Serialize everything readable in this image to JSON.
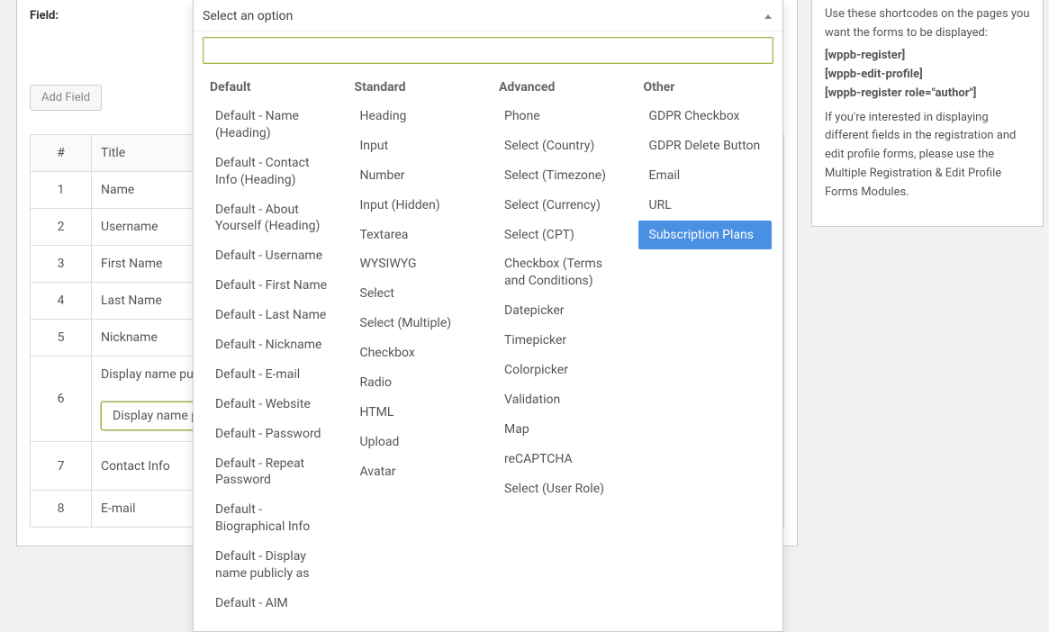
{
  "field_label": "Field:",
  "add_field_label": "Add Field",
  "table": {
    "headers": {
      "num": "#",
      "title": "Title"
    },
    "rows": [
      {
        "num": "1",
        "title": "Name"
      },
      {
        "num": "2",
        "title": "Username"
      },
      {
        "num": "3",
        "title": "First Name"
      },
      {
        "num": "4",
        "title": "Last Name"
      },
      {
        "num": "5",
        "title": "Nickname"
      },
      {
        "num": "6",
        "title": "Display name pu",
        "inline_select": "Display name p"
      },
      {
        "num": "7",
        "title": "Contact Info"
      },
      {
        "num": "8",
        "title": "E-mail"
      }
    ]
  },
  "sidebar": {
    "intro": "Use these shortcodes on the pages you want the forms to be displayed:",
    "shortcodes": [
      "[wppb-register]",
      "[wppb-edit-profile]",
      "[wppb-register role=\"author\"]"
    ],
    "outro": "If you're interested in displaying different fields in the registration and edit profile forms, please use the Multiple Registration & Edit Profile Forms Modules."
  },
  "dropdown": {
    "placeholder_header": "Select an option",
    "search_value": "",
    "columns": [
      {
        "heading": "Default",
        "items": [
          "Default - Name (Heading)",
          "Default - Contact Info (Heading)",
          "Default - About Yourself (Heading)",
          "Default - Username",
          "Default - First Name",
          "Default - Last Name",
          "Default - Nickname",
          "Default - E-mail",
          "Default - Website",
          "Default - Password",
          "Default - Repeat Password",
          "Default - Biographical Info",
          "Default - Display name publicly as",
          "Default - AIM"
        ]
      },
      {
        "heading": "Standard",
        "items": [
          "Heading",
          "Input",
          "Number",
          "Input (Hidden)",
          "Textarea",
          "WYSIWYG",
          "Select",
          "Select (Multiple)",
          "Checkbox",
          "Radio",
          "HTML",
          "Upload",
          "Avatar"
        ]
      },
      {
        "heading": "Advanced",
        "items": [
          "Phone",
          "Select (Country)",
          "Select (Timezone)",
          "Select (Currency)",
          "Select (CPT)",
          "Checkbox (Terms and Conditions)",
          "Datepicker",
          "Timepicker",
          "Colorpicker",
          "Validation",
          "Map",
          "reCAPTCHA",
          "Select (User Role)"
        ]
      },
      {
        "heading": "Other",
        "items": [
          "GDPR Checkbox",
          "GDPR Delete Button",
          "Email",
          "URL",
          "Subscription Plans"
        ],
        "highlight_index": 4
      }
    ]
  }
}
